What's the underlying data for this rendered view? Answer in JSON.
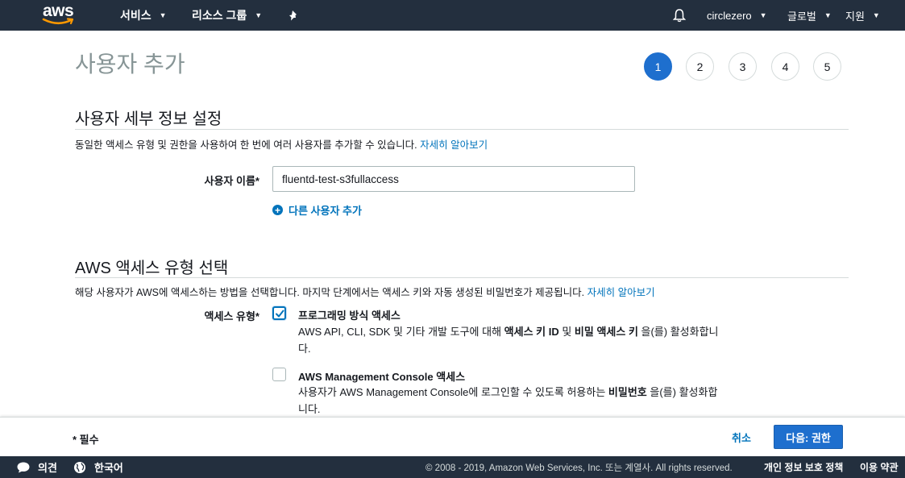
{
  "topnav": {
    "logo_text": "aws",
    "services_label": "서비스",
    "resource_groups_label": "리소스 그룹",
    "account_label": "circlezero",
    "region_label": "글로벌",
    "support_label": "지원"
  },
  "header": {
    "title": "사용자 추가",
    "steps": [
      "1",
      "2",
      "3",
      "4",
      "5"
    ],
    "active_step": "1"
  },
  "user_details": {
    "section_title": "사용자 세부 정보 설정",
    "description": "동일한 액세스 유형 및 권한을 사용하여 한 번에 여러 사용자를 추가할 수 있습니다.",
    "learn_more": "자세히 알아보기",
    "username_label": "사용자 이름*",
    "username_value": "fluentd-test-s3fullaccess",
    "add_another_user": "다른 사용자 추가"
  },
  "access_type": {
    "section_title": "AWS 액세스 유형 선택",
    "description": "해당 사용자가 AWS에 액세스하는 방법을 선택합니다. 마지막 단계에서는 액세스 키와 자동 생성된 비밀번호가 제공됩니다.",
    "learn_more": "자세히 알아보기",
    "label": "액세스 유형*",
    "options": [
      {
        "title": "프로그래밍 방식 액세스",
        "checked": true,
        "desc_parts": [
          "AWS API, CLI, SDK 및 기타 개발 도구에 대해 ",
          "액세스 키 ID",
          " 및 ",
          "비밀 액세스 키",
          " 을(를) 활성화합니",
          "다."
        ]
      },
      {
        "title": "AWS Management Console 액세스",
        "checked": false,
        "desc_parts": [
          "사용자가 AWS Management Console에 로그인할 수 있도록 허용하는 ",
          "비밀번호",
          " 을(를) 활성화합",
          "니다."
        ]
      }
    ]
  },
  "actionbar": {
    "required_note": "* 필수",
    "cancel_label": "취소",
    "next_label": "다음: 권한"
  },
  "footer": {
    "feedback_label": "의견",
    "language_label": "한국어",
    "copyright": "© 2008 - 2019, Amazon Web Services, Inc. 또는 계열사. All rights reserved.",
    "privacy_label": "개인 정보 보호 정책",
    "terms_label": "이용 약관"
  },
  "colors": {
    "nav_bg": "#232f3e",
    "primary": "#1e6fce",
    "link": "#0073bb"
  }
}
